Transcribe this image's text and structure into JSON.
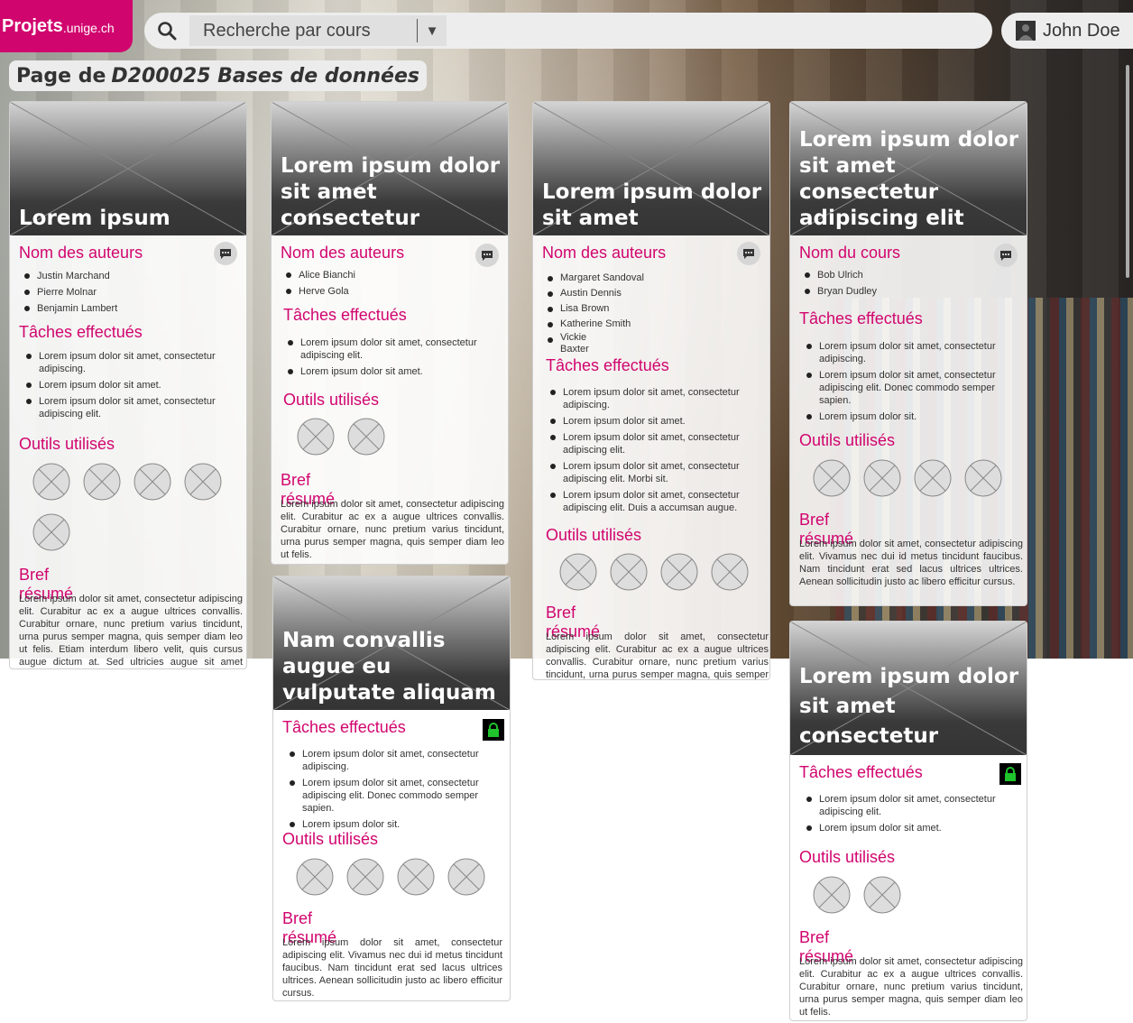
{
  "brand": {
    "name": "Projets",
    "domain": ".unige.ch",
    "color": "#d1056e"
  },
  "search": {
    "placeholder": "Recherche par cours"
  },
  "user": {
    "name": "John Doe"
  },
  "page": {
    "prefix": "Page de",
    "course": "D200025 Bases de données"
  },
  "labels": {
    "authors": "Nom des auteurs",
    "course_name": "Nom du cours",
    "tasks": "Tâches effectués",
    "tools": "Outils utilisés",
    "summary": "Bref résumé"
  },
  "cards": [
    {
      "title": "Lorem ipsum",
      "names": [
        "Justin Marchand",
        "Pierre Molnar",
        "Benjamin Lambert"
      ],
      "tasks": [
        "Lorem ipsum dolor sit amet, consectetur adipiscing.",
        "Lorem ipsum dolor sit amet.",
        "Lorem ipsum dolor sit amet, consectetur adipiscing elit."
      ],
      "summary": "Lorem ipsum dolor sit amet, consectetur adipiscing elit. Curabitur ac ex a augue ultrices convallis. Curabitur ornare, nunc pretium varius tincidunt, urna purus semper magna, quis semper diam leo ut felis. Etiam interdum libero velit, quis cursus augue dictum at. Sed ultricies augue sit amet bibendum dictum."
    },
    {
      "title": "Lorem ipsum dolor sit amet consectetur",
      "names": [
        "Alice Bianchi",
        "Herve Gola"
      ],
      "tasks": [
        "Lorem ipsum dolor sit amet, consectetur adipiscing elit.",
        "Lorem ipsum dolor sit amet."
      ],
      "summary": "Lorem ipsum dolor sit amet, consectetur adipiscing elit. Curabitur ac ex a augue ultrices convallis. Curabitur ornare, nunc pretium varius tincidunt, urna purus semper magna, quis semper diam leo ut felis."
    },
    {
      "title": "Lorem ipsum dolor sit amet",
      "names": [
        "Margaret Sandoval",
        "Austin Dennis",
        "Lisa Brown",
        "Katherine Smith",
        "Vickie Baxter"
      ],
      "tasks": [
        "Lorem ipsum dolor sit amet, consectetur adipiscing.",
        "Lorem ipsum dolor sit amet.",
        "Lorem ipsum dolor sit amet, consectetur adipiscing elit.",
        "Lorem ipsum dolor sit amet, consectetur adipiscing elit. Morbi sit.",
        "Lorem ipsum dolor sit amet, consectetur adipiscing elit. Duis a accumsan augue."
      ],
      "summary": "Lorem ipsum dolor sit amet, consectetur adipiscing elit. Curabitur ac ex a augue ultrices convallis. Curabitur ornare, nunc pretium varius tincidunt, urna purus semper magna, quis semper diam leo ut felis."
    },
    {
      "title": "Lorem ipsum dolor sit amet consectetur adipiscing elit",
      "names": [
        "Bob Ulrich",
        "Bryan Dudley"
      ],
      "tasks": [
        "Lorem ipsum dolor sit amet, consectetur adipiscing.",
        "Lorem ipsum dolor sit amet, consectetur adipiscing elit. Donec commodo semper sapien.",
        "Lorem ipsum dolor sit."
      ],
      "summary": "Lorem ipsum dolor sit amet, consectetur adipiscing elit. Vivamus nec dui id metus tincidunt faucibus. Nam tincidunt erat sed lacus ultrices ultrices. Aenean sollicitudin justo ac libero efficitur cursus."
    },
    {
      "title": "Nam convallis augue eu vulputate aliquam",
      "tasks": [
        "Lorem ipsum dolor sit amet, consectetur adipiscing.",
        "Lorem ipsum dolor sit amet, consectetur adipiscing elit. Donec commodo semper sapien.",
        "Lorem ipsum dolor sit."
      ],
      "summary": "Lorem ipsum dolor sit amet, consectetur adipiscing elit. Vivamus nec dui id metus tincidunt faucibus. Nam tincidunt erat sed lacus ultrices ultrices. Aenean sollicitudin justo ac libero efficitur cursus."
    },
    {
      "title": "Lorem ipsum dolor sit amet consectetur",
      "tasks": [
        "Lorem ipsum dolor sit amet, consectetur adipiscing elit.",
        "Lorem ipsum dolor sit amet."
      ],
      "summary": "Lorem ipsum dolor sit amet, consectetur adipiscing elit. Curabitur ac ex a augue ultrices convallis. Curabitur ornare, nunc pretium varius tincidunt, urna purus semper magna, quis semper diam leo ut felis."
    }
  ]
}
